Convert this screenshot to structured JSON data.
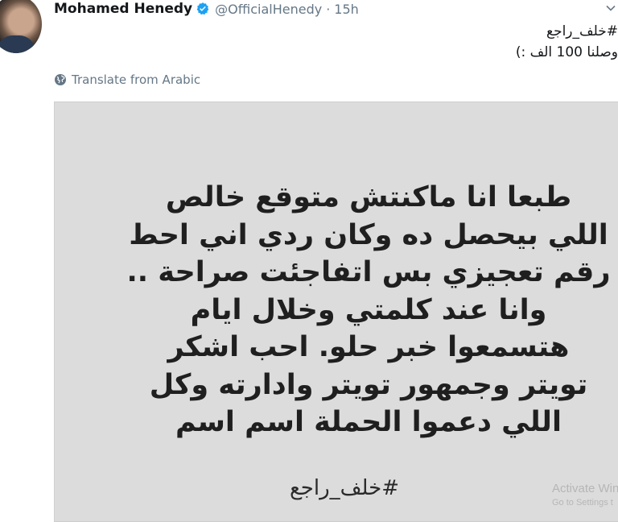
{
  "tweet": {
    "author_name": "Mohamed Henedy",
    "handle": "@OfficialHenedy",
    "separator": "·",
    "time": "15h",
    "text_lines": [
      "#خلف_راجع",
      "وصلنا 100 الف :)"
    ],
    "translate_label": "Translate from Arabic"
  },
  "image_card": {
    "lines": [
      "طبعا انا ماكنتش متوقع خالص",
      "اللي بيحصل ده وكان ردي اني احط",
      "رقم تعجيزي بس اتفاجئت صراحة ..",
      "وانا عند كلمتي وخلال ايام",
      "هتسمعوا خبر حلو. احب اشكر",
      "تويتر  وجمهور تويتر وادارته وكل",
      "اللي دعموا الحملة اسم اسم"
    ],
    "hashtag": "#خلف_راجع"
  },
  "watermark": {
    "line1": "Activate Win",
    "line2": "Go to Settings t"
  },
  "colors": {
    "verified_blue": "#1da1f2",
    "secondary_text": "#657786",
    "card_bg": "#dcdcdc"
  },
  "icons": {
    "verified": "verified-badge-icon",
    "globe": "globe-icon",
    "chevron": "chevron-down-icon"
  }
}
